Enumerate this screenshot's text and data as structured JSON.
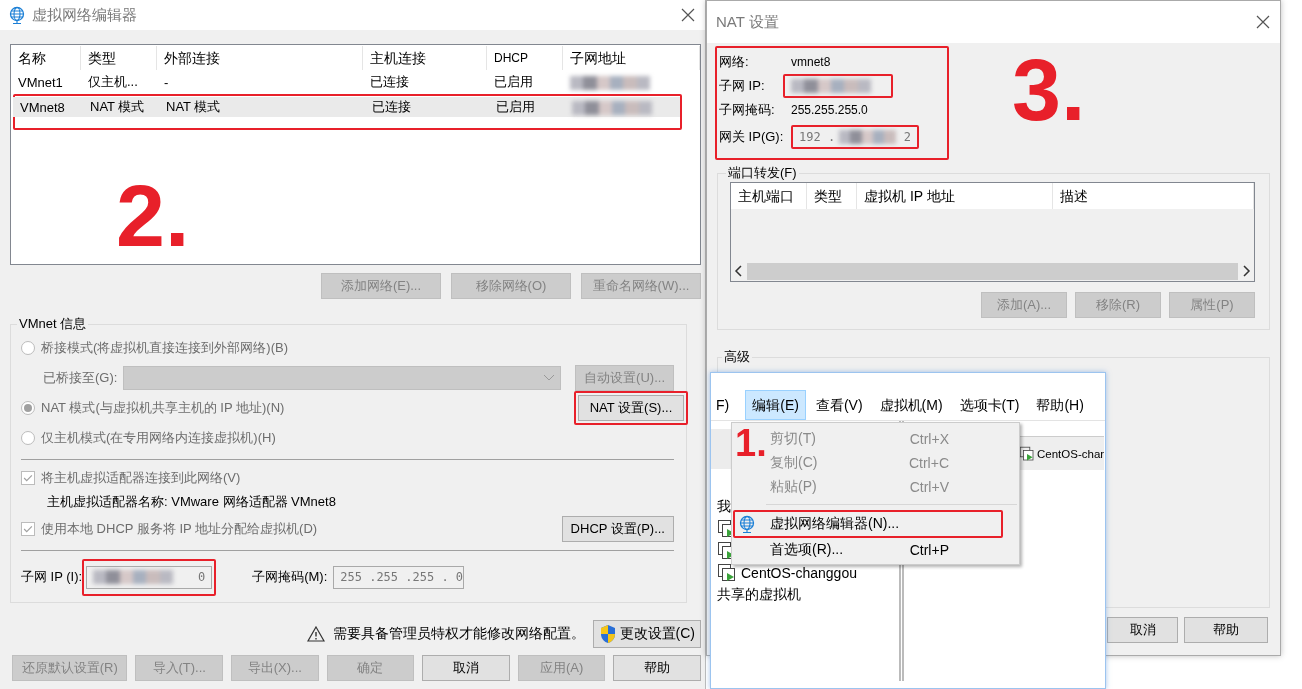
{
  "editor_window": {
    "title": "虚拟网络编辑器",
    "annotation": "2.",
    "columns": [
      "名称",
      "类型",
      "外部连接",
      "主机连接",
      "DHCP",
      "子网地址"
    ],
    "rows": [
      {
        "name": "VMnet1",
        "type": "仅主机...",
        "external": "-",
        "host": "已连接",
        "dhcp": "已启用",
        "selected": false
      },
      {
        "name": "VMnet8",
        "type": "NAT 模式",
        "external": "NAT 模式",
        "host": "已连接",
        "dhcp": "已启用",
        "selected": true
      }
    ],
    "network_buttons": [
      {
        "label": "添加网络(E)...",
        "disabled": true
      },
      {
        "label": "移除网络(O)",
        "disabled": true
      },
      {
        "label": "重命名网络(W)...",
        "disabled": true
      }
    ],
    "vmnet_info": {
      "legend": "VMnet 信息",
      "disabled": true,
      "options": [
        {
          "label": "桥接模式(将虚拟机直接连接到外部网络)(B)",
          "selected": false
        },
        {
          "label": "NAT 模式(与虚拟机共享主机的 IP 地址)(N)",
          "selected": true
        },
        {
          "label": "仅主机模式(在专用网络内连接虚拟机)(H)",
          "selected": false
        }
      ],
      "bridged_label": "已桥接至(G):",
      "auto_button": "自动设置(U)...",
      "nat_button": "NAT 设置(S)...",
      "connect_adapter": {
        "label": "将主机虚拟适配器连接到此网络(V)",
        "checked": true
      },
      "adapter_name": "主机虚拟适配器名称: VMware 网络适配器 VMnet8",
      "dhcp": {
        "label": "使用本地 DHCP 服务将 IP 地址分配给虚拟机(D)",
        "checked": true
      },
      "dhcp_button": "DHCP 设置(P)...",
      "subnet_ip_label": "子网 IP (I):",
      "subnet_ip_tail": "0",
      "subnet_mask_label": "子网掩码(M):",
      "subnet_mask": "255 .255 .255 . 0"
    },
    "warning": "需要具备管理员特权才能修改网络配置。",
    "change_button": "更改设置(C)",
    "footer_buttons": [
      {
        "label": "还原默认设置(R)",
        "disabled": true
      },
      {
        "label": "导入(T)...",
        "disabled": true
      },
      {
        "label": "导出(X)...",
        "disabled": true
      },
      {
        "label": "确定",
        "disabled": true
      },
      {
        "label": "取消",
        "disabled": false
      },
      {
        "label": "应用(A)",
        "disabled": true
      },
      {
        "label": "帮助",
        "disabled": false
      }
    ]
  },
  "nat_window": {
    "title": "NAT 设置",
    "annotation": "3.",
    "network_label": "网络:",
    "network": "vmnet8",
    "subnet_ip_label": "子网 IP:",
    "subnet_mask_label": "子网掩码:",
    "subnet_mask": "255.255.255.0",
    "gateway_label": "网关 IP(G):",
    "gateway_head": "192 .",
    "gateway_tail": "2",
    "port_forward": {
      "legend": "端口转发(F)",
      "columns": [
        "主机端口",
        "类型",
        "虚拟机 IP 地址",
        "描述"
      ],
      "buttons": [
        {
          "label": "添加(A)...",
          "disabled": true
        },
        {
          "label": "移除(R)",
          "disabled": true
        },
        {
          "label": "属性(P)",
          "disabled": true
        }
      ]
    },
    "advanced_legend": "高级",
    "footer_buttons": [
      "取消",
      "帮助"
    ]
  },
  "main_window": {
    "annotation": "1.",
    "menu": [
      {
        "label": "F)",
        "selected": false
      },
      {
        "label": "编辑(E)",
        "selected": true
      },
      {
        "label": "查看(V)",
        "selected": false
      },
      {
        "label": "虚拟机(M)",
        "selected": false
      },
      {
        "label": "选项卡(T)",
        "selected": false
      },
      {
        "label": "帮助(H)",
        "selected": false
      }
    ],
    "tree": [
      {
        "kind": "heading",
        "label": "我"
      },
      {
        "kind": "vm"
      },
      {
        "kind": "vm"
      },
      {
        "kind": "vm",
        "label": "CentOS-changgou"
      },
      {
        "kind": "heading",
        "label": "共享的虚拟机"
      }
    ],
    "tab": "CentOS-char",
    "edit_menu": [
      {
        "kind": "item",
        "label": "剪切(T)",
        "shortcut": "Ctrl+X",
        "disabled": true
      },
      {
        "kind": "item",
        "label": "复制(C)",
        "shortcut": "Ctrl+C",
        "disabled": true
      },
      {
        "kind": "item",
        "label": "粘贴(P)",
        "shortcut": "Ctrl+V",
        "disabled": true
      },
      {
        "kind": "separator"
      },
      {
        "kind": "icon_item",
        "label": "虚拟网络编辑器(N)...",
        "disabled": false
      },
      {
        "kind": "item",
        "label": "首选项(R)...",
        "shortcut": "Ctrl+P",
        "disabled": false
      }
    ]
  }
}
